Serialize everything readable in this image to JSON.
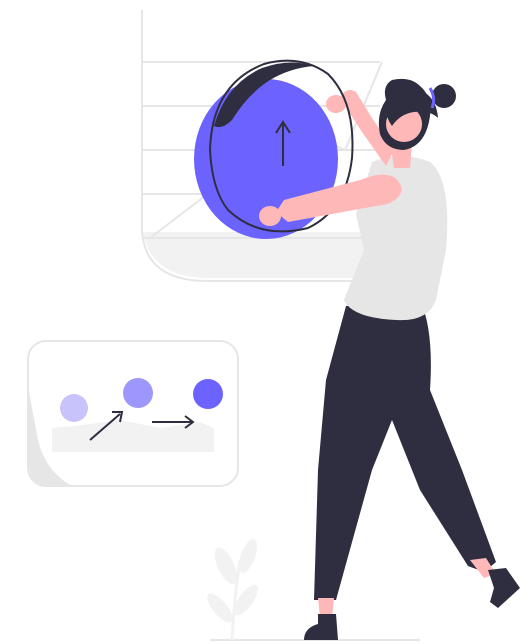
{
  "illustration": {
    "style": "flat vector illustration, no visible text",
    "palette": {
      "accent": "#6c63ff",
      "accent_light": "#c8c4fb",
      "accent_mid": "#9d97fc",
      "dark": "#2f2e41",
      "skin": "#ffb8b8",
      "shirt": "#e6e6e6",
      "panel_border": "#e6e6e6",
      "panel_fill": "#f2f2f2",
      "grid_line": "#e6e6e6"
    },
    "icons": {
      "growth_arrow": "arrow-up-icon",
      "progress_arrow_diagonal": "arrow-up-right-icon",
      "progress_arrow_right": "arrow-right-icon"
    },
    "progress_steps": 3
  }
}
